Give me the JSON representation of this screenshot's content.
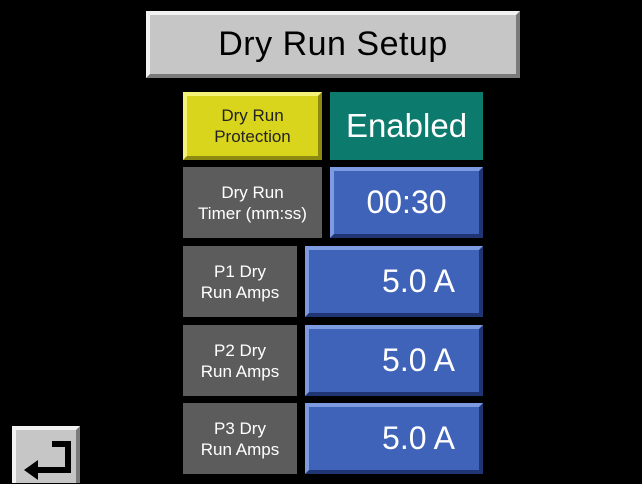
{
  "header": {
    "title": "Dry Run Setup"
  },
  "rows": [
    {
      "label_line1": "Dry Run",
      "label_line2": "Protection",
      "value": "Enabled"
    },
    {
      "label_line1": "Dry Run",
      "label_line2": "Timer (mm:ss)",
      "value": "00:30"
    },
    {
      "label_line1": "P1 Dry",
      "label_line2": "Run Amps",
      "value": "5.0 A"
    },
    {
      "label_line1": "P2 Dry",
      "label_line2": "Run Amps",
      "value": "5.0 A"
    },
    {
      "label_line1": "P3 Dry",
      "label_line2": "Run Amps",
      "value": "5.0 A"
    }
  ],
  "footer": {
    "back_icon": "return-arrow-icon"
  },
  "colors": {
    "background": "#000000",
    "title_panel": "#c6c6c6",
    "protection_label": "#d8d51c",
    "enabled_status": "#0d7a6e",
    "value_button": "#3f63b8",
    "label_cell": "#5c5c5c"
  }
}
